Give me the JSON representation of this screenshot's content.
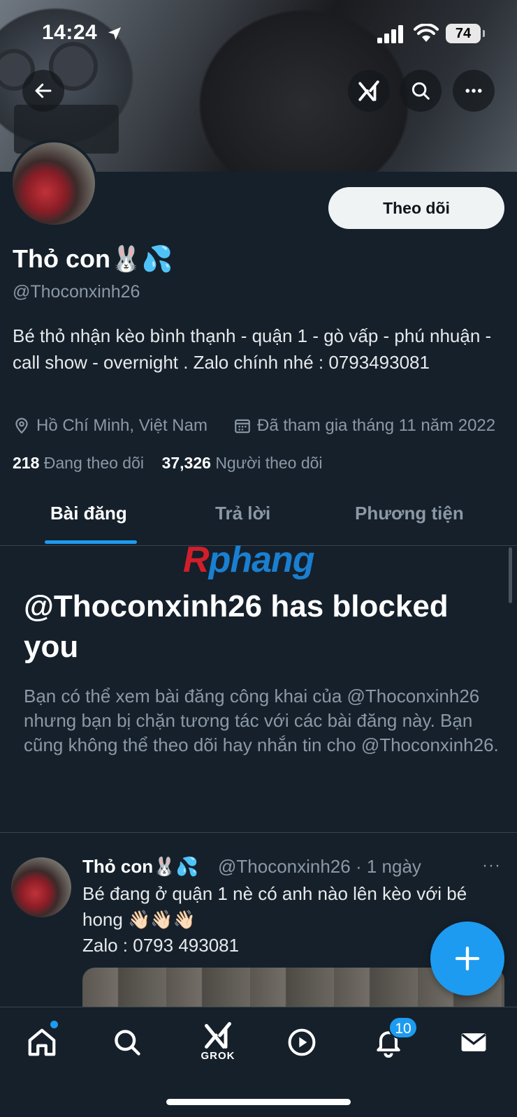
{
  "status_bar": {
    "time": "14:24",
    "battery": "74"
  },
  "banner_buttons": {
    "back_icon": "arrow-left-icon",
    "grok_icon": "grok-icon",
    "search_icon": "search-icon",
    "more_icon": "more-icon"
  },
  "profile": {
    "follow_label": "Theo dõi",
    "name": "Thỏ con🐰💦",
    "handle": "@Thoconxinh26",
    "bio": "Bé thỏ nhận kèo bình thạnh - quận 1 - gò vấp - phú nhuận - call show - overnight . Zalo chính nhé : 0793493081",
    "location": "Hồ Chí Minh, Việt Nam",
    "joined": "Đã tham gia tháng 11 năm 2022",
    "following_count": "218",
    "following_label": "Đang theo dõi",
    "followers_count": "37,326",
    "followers_label": "Người theo dõi"
  },
  "tabs": [
    {
      "label": "Bài đăng",
      "active": true
    },
    {
      "label": "Trả lời",
      "active": false
    },
    {
      "label": "Phương tiện",
      "active": false
    }
  ],
  "watermark": {
    "first": "R",
    "rest": "phang"
  },
  "blocked": {
    "title": "@Thoconxinh26 has blocked you",
    "description": "Bạn có thể xem bài đăng công khai của @Thoconxinh26 nhưng bạn bị chặn tương tác với các bài đăng này. Bạn cũng không thể theo dõi hay nhắn tin cho @Thoconxinh26."
  },
  "tweet": {
    "name": "Thỏ con🐰💦",
    "handle_time": "@Thoconxinh26 · 1 ngày",
    "more": "···",
    "line1": "Bé đang ở quận 1 nè có anh nào lên kèo với bé",
    "line2": "hong 👋🏻👋🏻👋🏻",
    "line3": "Zalo : 0793 493081"
  },
  "fab": {
    "icon": "plus-icon"
  },
  "bottom_nav": {
    "grok_label": "GROK",
    "notifications_badge": "10",
    "items": [
      "home-icon",
      "search-icon",
      "grok-icon",
      "play-icon",
      "bell-icon",
      "mail-icon"
    ]
  },
  "colors": {
    "background": "#15202b",
    "accent": "#1d9bf0",
    "muted": "#8b98a5"
  }
}
